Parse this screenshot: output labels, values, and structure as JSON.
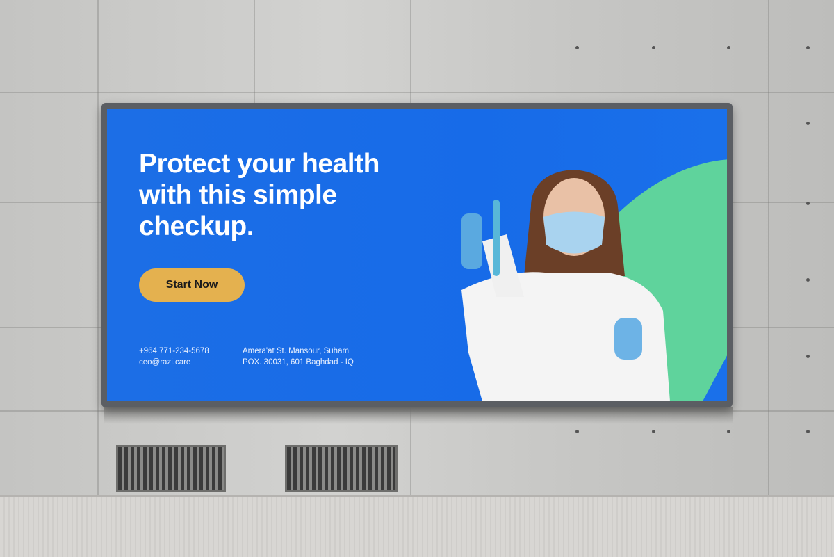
{
  "billboard": {
    "headline": "Protect your health\nwith this simple\ncheckup.",
    "cta_label": "Start Now",
    "phone": "+964 771-234-5678",
    "email": "ceo@razi.care",
    "address_line1": "Amera'at St. Mansour, Suham",
    "address_line2": "POX. 30031, 601 Baghdad - IQ"
  },
  "colors": {
    "background_blue": "#1a6fe8",
    "accent_green": "#5fd39c",
    "button_yellow": "#e4b14f"
  }
}
